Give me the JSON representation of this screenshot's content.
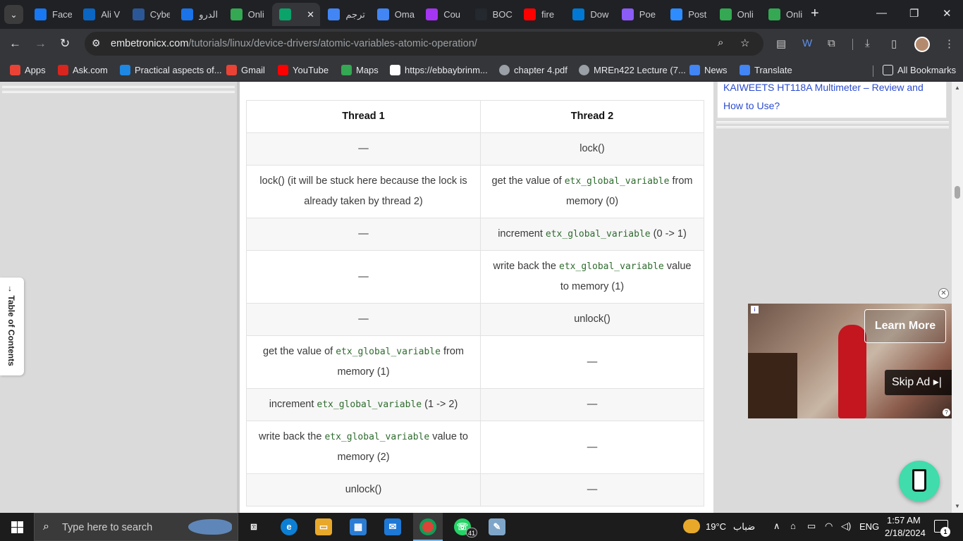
{
  "browser": {
    "tabs": [
      {
        "label": "Face",
        "icon": "facebook-icon",
        "color": "#1877f2"
      },
      {
        "label": "Ali V",
        "icon": "linkedin-icon",
        "color": "#0a66c2"
      },
      {
        "label": "Cybe",
        "icon": "cyber-icon",
        "color": "#2b5797"
      },
      {
        "label": "الدرو",
        "icon": "gear-icon",
        "color": "#1a73e8"
      },
      {
        "label": "Onli",
        "icon": "google-drive-icon",
        "color": "#34a853"
      },
      {
        "label": "",
        "icon": "diamond-icon",
        "color": "#0aa36a",
        "active": true
      },
      {
        "label": "ترجم",
        "icon": "google-translate-icon",
        "color": "#4285f4"
      },
      {
        "label": "Oma",
        "icon": "docs-icon",
        "color": "#4285f4"
      },
      {
        "label": "Cou",
        "icon": "udemy-icon",
        "color": "#a435f0"
      },
      {
        "label": "BOC",
        "icon": "github-icon",
        "color": "#24292f"
      },
      {
        "label": "fire",
        "icon": "youtube-icon",
        "color": "#ff0000"
      },
      {
        "label": "Dow",
        "icon": "download-site-icon",
        "color": "#0078d4"
      },
      {
        "label": "Poe",
        "icon": "poe-icon",
        "color": "#8b5cf6"
      },
      {
        "label": "Post",
        "icon": "zoom-icon",
        "color": "#2d8cff"
      },
      {
        "label": "Onli",
        "icon": "google-drive-icon",
        "color": "#34a853"
      },
      {
        "label": "Onli",
        "icon": "google-drive-icon",
        "color": "#34a853"
      }
    ],
    "url_host": "embetronicx.com",
    "url_path": "/tutorials/linux/device-drivers/atomic-variables-atomic-operation/",
    "bookmarks": [
      {
        "label": "Apps",
        "icon": "apps-grid-icon",
        "color": "#ea4335"
      },
      {
        "label": "Ask.com",
        "icon": "ask-icon",
        "color": "#d9251d"
      },
      {
        "label": "Practical aspects of...",
        "icon": "c-icon",
        "color": "#1e88e5"
      },
      {
        "label": "Gmail",
        "icon": "gmail-icon",
        "color": "#ea4335"
      },
      {
        "label": "YouTube",
        "icon": "youtube-icon",
        "color": "#ff0000"
      },
      {
        "label": "Maps",
        "icon": "maps-icon",
        "color": "#34a853"
      },
      {
        "label": "https://ebbaybrinm...",
        "icon": "page-icon",
        "color": "#ffffff"
      },
      {
        "label": "chapter 4.pdf",
        "icon": "globe-icon",
        "color": "#9aa0a6"
      },
      {
        "label": "MREn422 Lecture (7...",
        "icon": "globe-icon",
        "color": "#9aa0a6"
      },
      {
        "label": "News",
        "icon": "news-icon",
        "color": "#4285f4"
      },
      {
        "label": "Translate",
        "icon": "google-translate-icon",
        "color": "#4285f4"
      }
    ],
    "all_bookmarks": "All Bookmarks"
  },
  "page": {
    "toc_label": "Table of Contents",
    "sidebar_link": "KAIWEETS HT118A Multimeter – Review and How to Use?",
    "table": {
      "headers": [
        "Thread 1",
        "Thread 2"
      ],
      "rows": [
        [
          {
            "t": "—"
          },
          {
            "t": "lock()"
          }
        ],
        [
          {
            "t": "lock() (it will be stuck here because the lock is already taken by thread 2)"
          },
          {
            "pre": "get the value of ",
            "code": "etx_global_variable",
            "post": " from memory (0)"
          }
        ],
        [
          {
            "t": "—"
          },
          {
            "pre": "increment ",
            "code": "etx_global_variable",
            "post": " (0 -> 1)"
          }
        ],
        [
          {
            "t": "—"
          },
          {
            "pre": "write back the ",
            "code": "etx_global_variable",
            "post": " value to memory (1)"
          }
        ],
        [
          {
            "t": "—"
          },
          {
            "t": "unlock()"
          }
        ],
        [
          {
            "pre": "get the value of ",
            "code": "etx_global_variable",
            "post": " from memory (1)"
          },
          {
            "t": "—"
          }
        ],
        [
          {
            "pre": "increment ",
            "code": "etx_global_variable",
            "post": " (1 -> 2)"
          },
          {
            "t": "—"
          }
        ],
        [
          {
            "pre": "write back the ",
            "code": "etx_global_variable",
            "post": " value to memory (2)"
          },
          {
            "t": "—"
          }
        ],
        [
          {
            "t": "unlock()"
          },
          {
            "t": "—"
          }
        ]
      ]
    },
    "ad": {
      "learn_more": "Learn More",
      "skip_ad": "Skip Ad ▸|"
    }
  },
  "taskbar": {
    "search_placeholder": "Type here to search",
    "whatsapp_badge": "41",
    "weather_temp": "19°C",
    "weather_desc": "ضباب",
    "language": "ENG",
    "time": "1:57 AM",
    "date": "2/18/2024",
    "notification_count": "1"
  }
}
